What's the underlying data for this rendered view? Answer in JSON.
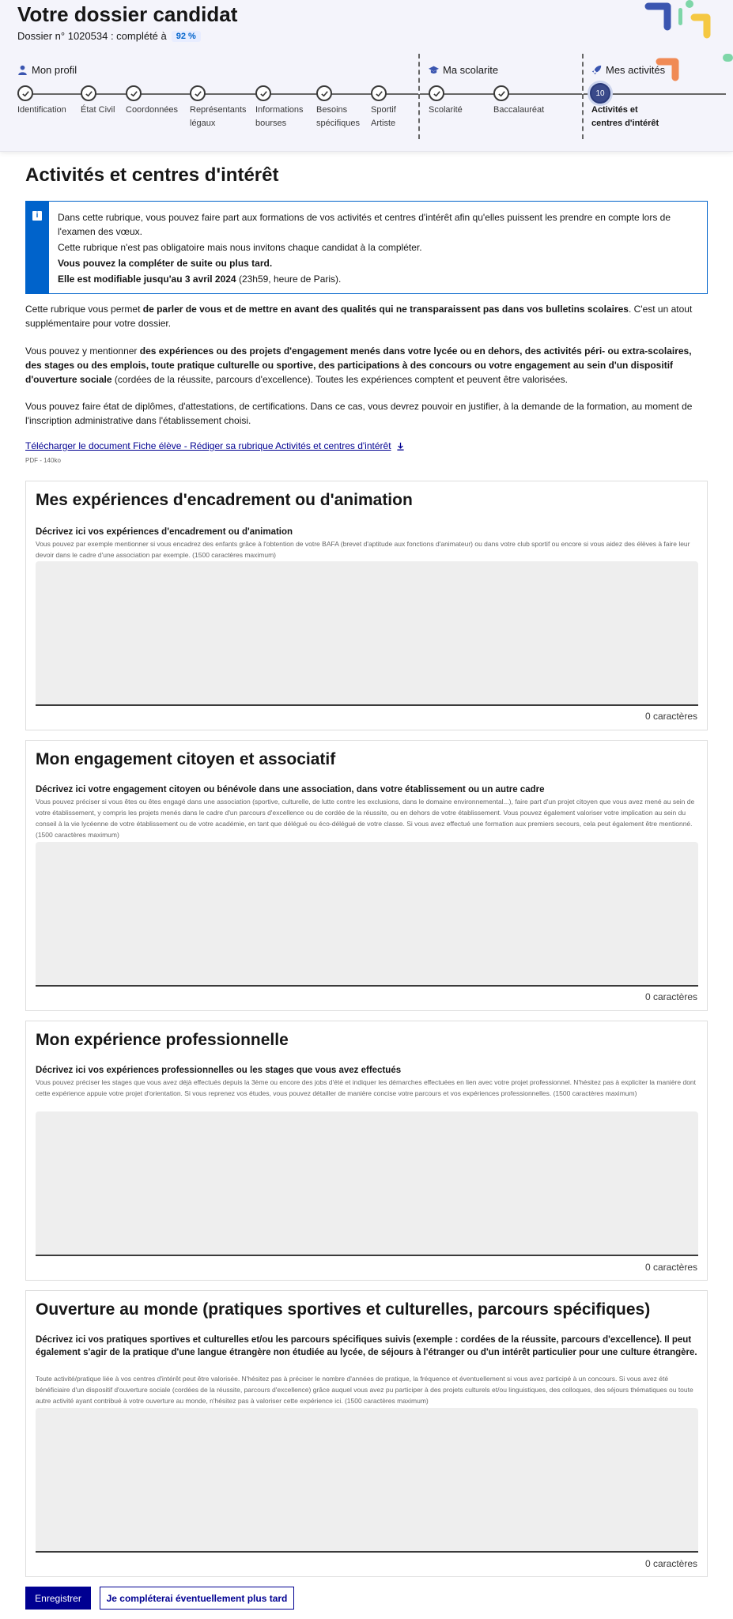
{
  "header": {
    "title": "Votre dossier candidat",
    "dossier_label": "Dossier n° 1020534 : complété à",
    "completion": "92 %"
  },
  "progress": {
    "groups": [
      {
        "label": "Mon profil",
        "icon": "user-icon"
      },
      {
        "label": "Ma scolarite",
        "icon": "graduation-cap-icon"
      },
      {
        "label": "Mes activités",
        "icon": "rocket-icon"
      }
    ],
    "steps": [
      {
        "label1": "Identification",
        "label2": "",
        "status": "done"
      },
      {
        "label1": "État Civil",
        "label2": "",
        "status": "done"
      },
      {
        "label1": "Coordonnées",
        "label2": "",
        "status": "done"
      },
      {
        "label1": "Représentants",
        "label2": "légaux",
        "status": "done"
      },
      {
        "label1": "Informations",
        "label2": "bourses",
        "status": "done"
      },
      {
        "label1": "Besoins",
        "label2": "spécifiques",
        "status": "done"
      },
      {
        "label1": "Sportif",
        "label2": "Artiste",
        "status": "done"
      },
      {
        "label1": "Scolarité",
        "label2": "",
        "status": "done"
      },
      {
        "label1": "Baccalauréat",
        "label2": "",
        "status": "done"
      },
      {
        "label1": "Activités et",
        "label2": "centres d'intérêt",
        "status": "current",
        "number": "10"
      }
    ]
  },
  "page": {
    "title": "Activités et centres d'intérêt",
    "notice": {
      "line1": "Dans cette rubrique, vous pouvez faire part aux formations de vos activités et centres d'intérêt afin qu'elles puissent les prendre en compte lors de l'examen des vœux.",
      "line2": "Cette rubrique n'est pas obligatoire mais nous invitons chaque candidat à la compléter.",
      "line3": "Vous pouvez la compléter de suite ou plus tard.",
      "line4_bold": "Elle est modifiable jusqu'au 3 avril 2024",
      "line4_rest": " (23h59, heure de Paris)."
    },
    "intro1_a": "Cette rubrique vous permet ",
    "intro1_b": "de parler de vous et de mettre en avant des qualités qui ne transparaissent pas dans vos bulletins scolaires",
    "intro1_c": ". C'est un atout supplémentaire pour votre dossier.",
    "intro2_a": "Vous pouvez y mentionner ",
    "intro2_b": "des expériences ou des projets d'engagement menés dans votre lycée ou en dehors, des activités péri- ou extra-scolaires, des stages ou des emplois, toute pratique culturelle ou sportive, des participations à des concours ou votre engagement au sein d'un dispositif d'ouverture sociale",
    "intro2_c": " (cordées de la réussite, parcours d'excellence). Toutes les expériences comptent et peuvent être valorisées.",
    "intro3": "Vous pouvez faire état de diplômes, d'attestations, de certifications. Dans ce cas, vous devrez pouvoir en justifier, à la demande de la formation, au moment de l'inscription administrative dans l'établissement choisi.",
    "download_link": "Télécharger le document Fiche élève - Rédiger sa rubrique Activités et centres d'intérêt",
    "download_meta": "PDF - 140ko"
  },
  "sections": [
    {
      "title": "Mes expériences d'encadrement ou d'animation",
      "label": "Décrivez ici vos expériences d'encadrement ou d'animation",
      "hint": "Vous pouvez par exemple mentionner si vous encadrez des enfants grâce à l'obtention de votre BAFA (brevet d'aptitude aux fonctions d'animateur) ou dans votre club sportif ou encore si vous aidez des élèves à faire leur devoir dans le cadre d'une association par exemple. (1500 caractères maximum)",
      "value": "",
      "counter": "0 caractères"
    },
    {
      "title": "Mon engagement citoyen et associatif",
      "label": "Décrivez ici votre engagement citoyen ou bénévole dans une association, dans votre établissement ou un autre cadre",
      "hint": "Vous pouvez préciser si vous êtes ou êtes engagé dans une association (sportive, culturelle, de lutte contre les exclusions, dans le domaine environnemental...), faire part d'un projet citoyen que vous avez mené au sein de votre établissement, y compris les projets menés dans le cadre d'un parcours d'excellence ou de cordée de la réussite, ou en dehors de votre établissement. Vous pouvez également valoriser votre implication au sein du conseil à la vie lycéenne de votre établissement ou de votre académie, en tant que délégué ou éco-délégué de votre classe. Si vous avez effectué une formation aux premiers secours, cela peut également être mentionné. (1500 caractères maximum)",
      "value": "",
      "counter": "0 caractères"
    },
    {
      "title": "Mon expérience professionnelle",
      "label": "Décrivez ici vos expériences professionnelles ou les stages que vous avez effectués",
      "hint": "Vous pouvez préciser les stages que vous avez déjà effectués depuis la 3ème ou encore des jobs d'été et indiquer les démarches effectuées en lien avec votre projet professionnel. N'hésitez pas à expliciter la manière dont cette expérience appuie votre projet d'orientation. Si vous reprenez vos études, vous pouvez détailler de manière concise votre parcours et vos expériences professionnelles. (1500 caractères maximum)",
      "value": "",
      "counter": "0 caractères"
    },
    {
      "title": "Ouverture au monde (pratiques sportives et culturelles, parcours spécifiques)",
      "label": "Décrivez ici vos pratiques sportives et culturelles et/ou les parcours spécifiques suivis (exemple : cordées de la réussite, parcours d'excellence). Il peut également s'agir de la pratique d'une langue étrangère non étudiée au lycée, de séjours à l'étranger ou d'un intérêt particulier pour une culture étrangère.",
      "hint": "Toute activité/pratique liée à vos centres d'intérêt peut être valorisée. N'hésitez pas à préciser le nombre d'années de pratique, la fréquence et éventuellement si vous avez participé à un concours. Si vous avez été bénéficiaire d'un dispositif d'ouverture sociale (cordées de la réussite, parcours d'excellence) grâce auquel vous avez pu participer à des projets culturels et/ou linguistiques, des colloques, des séjours thématiques ou toute autre activité ayant contribué à votre ouverture au monde, n'hésitez pas à valoriser cette expérience ici. (1500 caractères maximum)",
      "value": "",
      "counter": "0 caractères"
    }
  ],
  "actions": {
    "save": "Enregistrer",
    "later": "Je compléterai éventuellement plus tard"
  },
  "colors": {
    "primary": "#000091",
    "info": "#0063cb",
    "header_bg": "#f4f4fb"
  }
}
